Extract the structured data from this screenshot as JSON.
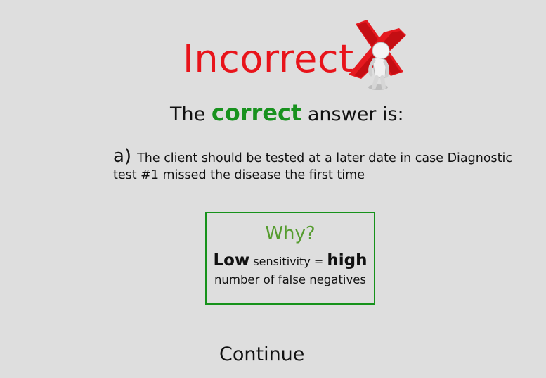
{
  "feedback": {
    "title": "Incorrect",
    "title_color": "#e8141b"
  },
  "answer_heading": {
    "prefix": "The",
    "highlight": "correct",
    "suffix": "answer is:",
    "highlight_color": "#18921e"
  },
  "answer": {
    "letter": "a)",
    "text": "The client should be tested at a later date in case Diagnostic test #1 missed the disease the first time"
  },
  "why_box": {
    "title": "Why?",
    "word_low": "Low",
    "word_sensitivity": "sensitivity",
    "equals": "=",
    "word_high": "high",
    "line2": "number of false negatives",
    "border_color": "#16921b",
    "title_color": "#559c2e"
  },
  "continue_label": "Continue",
  "icons": {
    "figure": "person-with-red-x-icon"
  }
}
